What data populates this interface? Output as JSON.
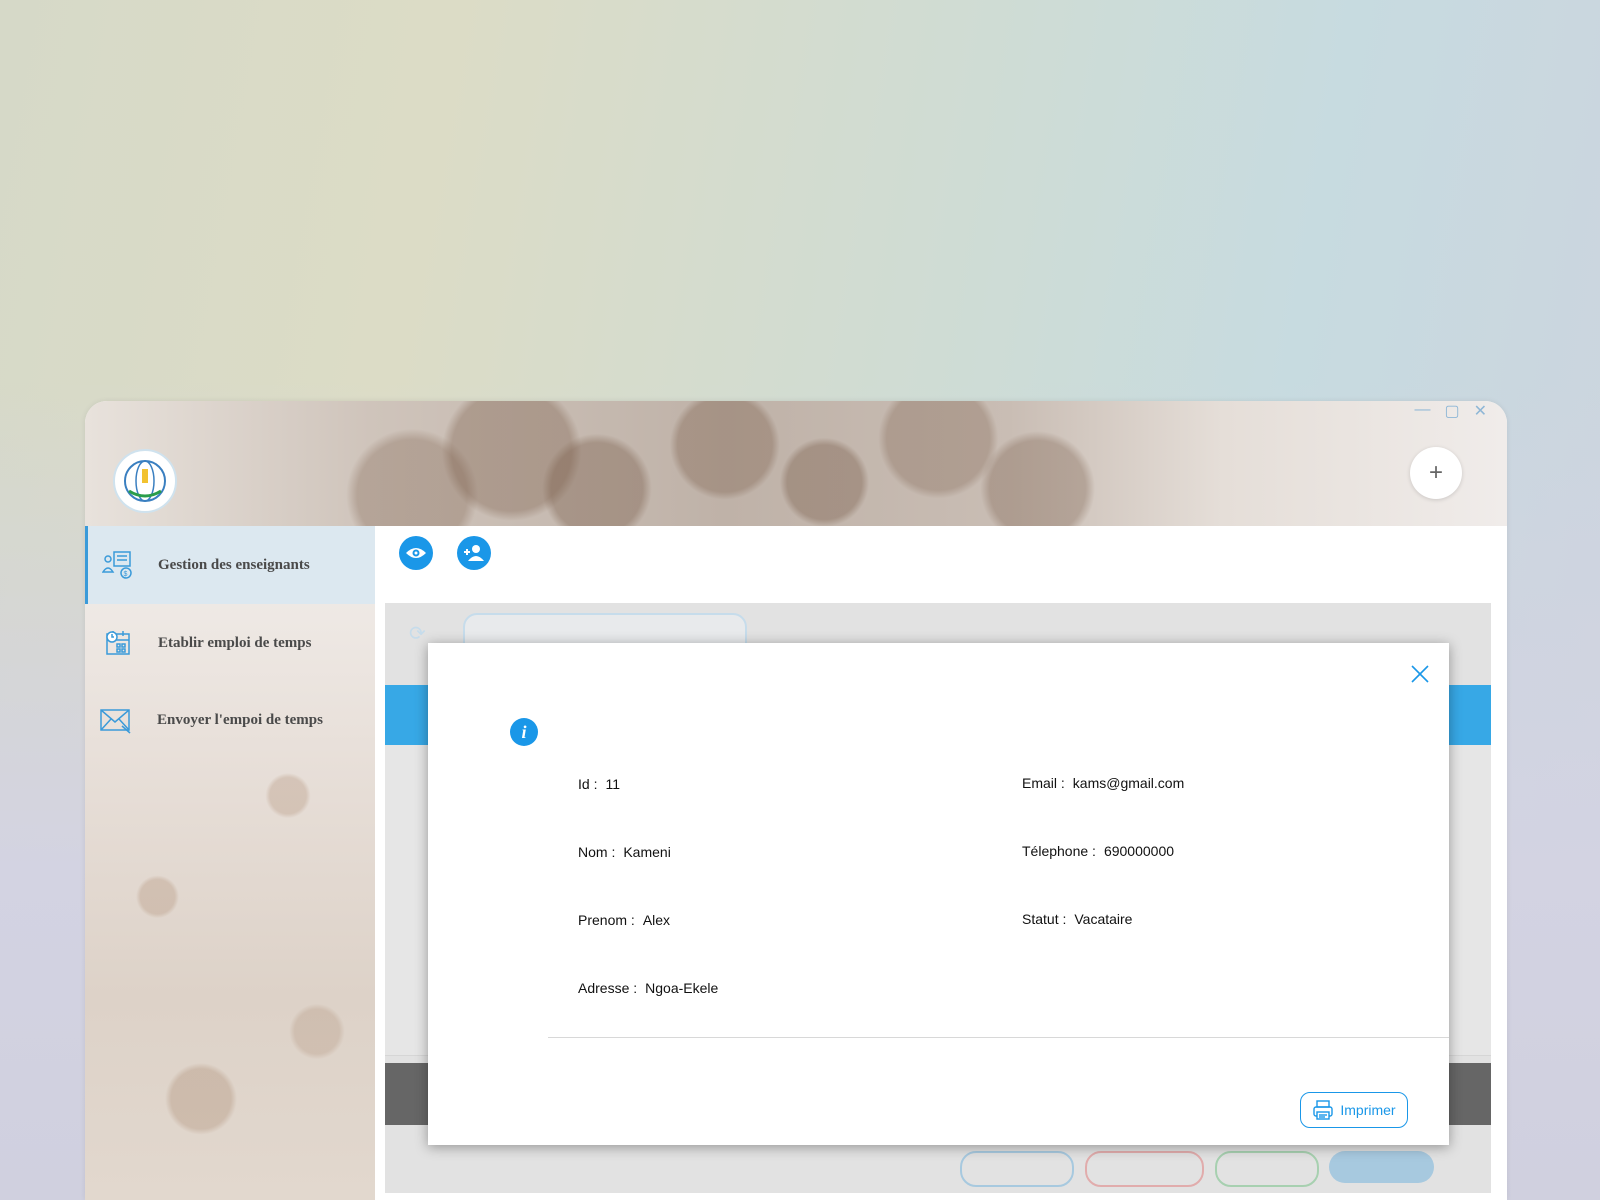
{
  "window": {
    "controls": {
      "minimize": "—",
      "maximize": "▢",
      "close": "✕"
    },
    "add_button": "+"
  },
  "sidebar": {
    "items": [
      {
        "label": "Gestion des enseignants",
        "icon": "teacher-management-icon",
        "active": true
      },
      {
        "label": "Etablir emploi de temps",
        "icon": "calendar-clock-icon",
        "active": false
      },
      {
        "label": "Envoyer  l'empoi de temps",
        "icon": "envelope-icon",
        "active": false
      }
    ]
  },
  "toolbar": {
    "view_icon": "eye-icon",
    "add_user_icon": "add-user-icon"
  },
  "modal": {
    "close_icon": "close-icon",
    "info_icon": "info-icon",
    "fields_left": [
      {
        "label": "Id :",
        "value": "11"
      },
      {
        "label": "Nom :",
        "value": "Kameni"
      },
      {
        "label": "Prenom :",
        "value": "Alex"
      },
      {
        "label": "Adresse :",
        "value": "Ngoa-Ekele"
      }
    ],
    "fields_right": [
      {
        "label": "Email :",
        "value": "kams@gmail.com"
      },
      {
        "label": "Télephone :",
        "value": "690000000"
      },
      {
        "label": "Statut :",
        "value": "Vacataire"
      }
    ],
    "print_button": "Imprimer"
  },
  "colors": {
    "accent": "#1a97e8",
    "active_sidebar": "#dce8f0"
  }
}
